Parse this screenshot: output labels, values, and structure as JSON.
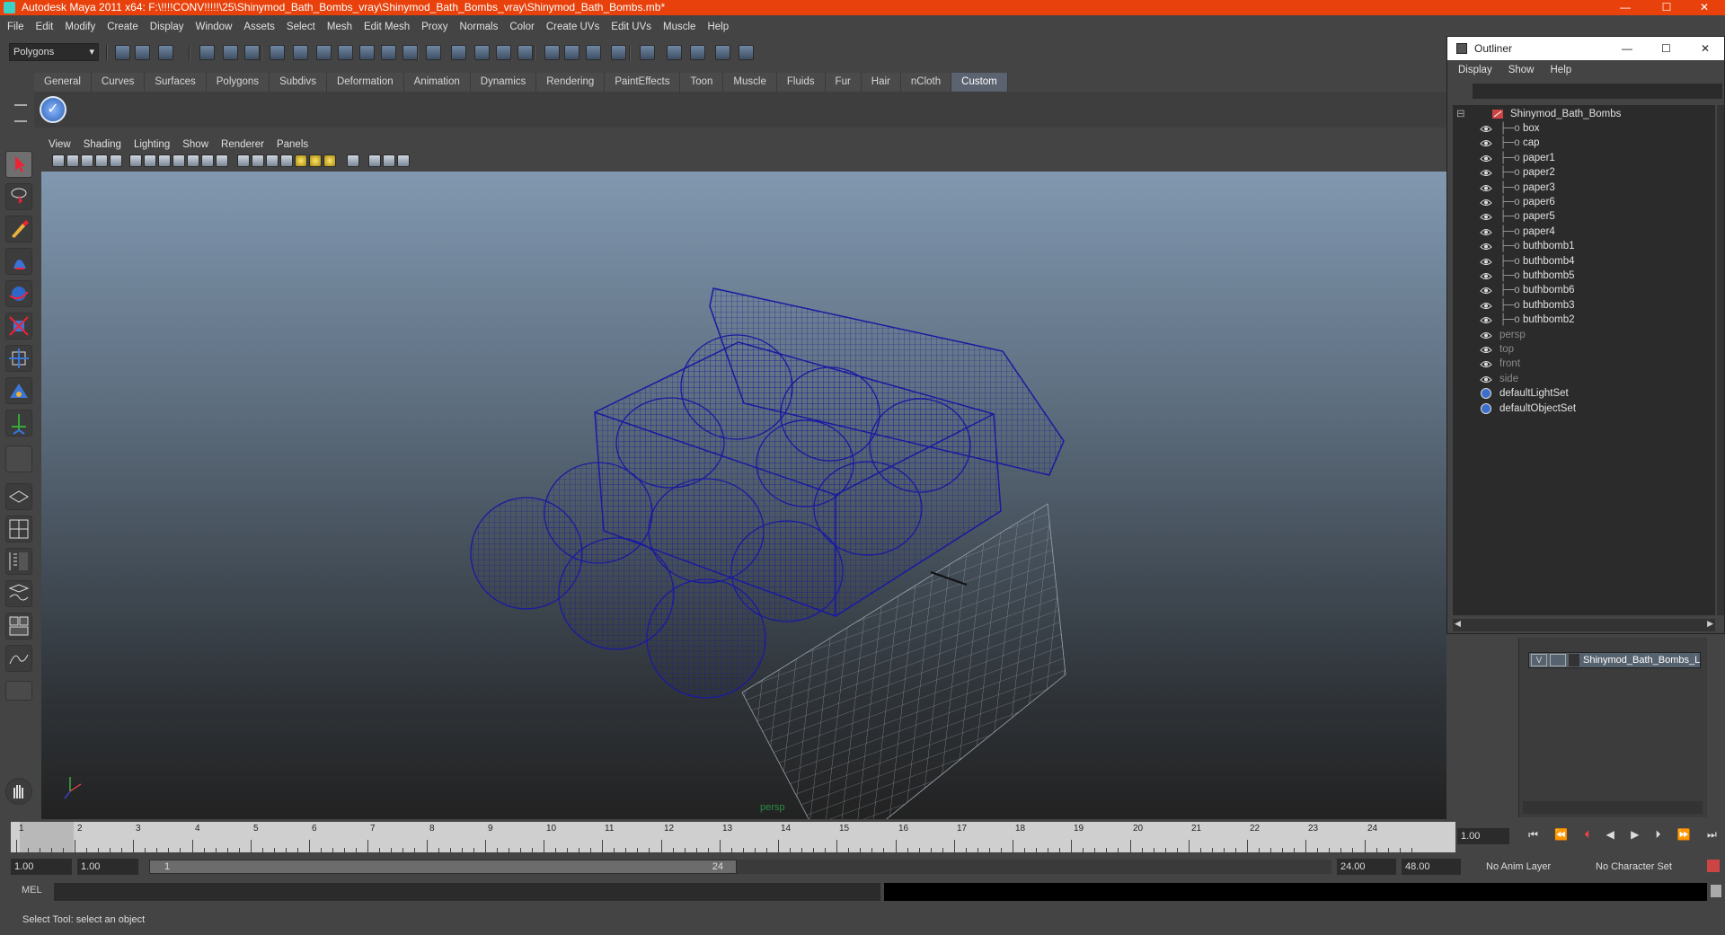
{
  "window": {
    "title": "Autodesk Maya 2011 x64: F:\\!!!!CONV!!!!!\\25\\Shinymod_Bath_Bombs_vray\\Shinymod_Bath_Bombs_vray\\Shinymod_Bath_Bombs.mb*",
    "minimize": "—",
    "maximize": "☐",
    "close": "✕"
  },
  "menubar": [
    "File",
    "Edit",
    "Modify",
    "Create",
    "Display",
    "Window",
    "Assets",
    "Select",
    "Mesh",
    "Edit Mesh",
    "Proxy",
    "Normals",
    "Color",
    "Create UVs",
    "Edit UVs",
    "Muscle",
    "Help"
  ],
  "statusline": {
    "mode": "Polygons"
  },
  "shelf": {
    "tabs": [
      "General",
      "Curves",
      "Surfaces",
      "Polygons",
      "Subdivs",
      "Deformation",
      "Animation",
      "Dynamics",
      "Rendering",
      "PaintEffects",
      "Toon",
      "Muscle",
      "Fluids",
      "Fur",
      "Hair",
      "nCloth",
      "Custom"
    ],
    "active": "Custom"
  },
  "viewport": {
    "menu": [
      "View",
      "Shading",
      "Lighting",
      "Show",
      "Renderer",
      "Panels"
    ],
    "camera": "persp"
  },
  "outliner": {
    "title": "Outliner",
    "menu": [
      "Display",
      "Show",
      "Help"
    ],
    "root": "Shinymod_Bath_Bombs",
    "children": [
      "box",
      "cap",
      "paper1",
      "paper2",
      "paper3",
      "paper6",
      "paper5",
      "paper4",
      "buthbomb1",
      "buthbomb4",
      "buthbomb5",
      "buthbomb6",
      "buthbomb3",
      "buthbomb2"
    ],
    "cameras": [
      "persp",
      "top",
      "front",
      "side"
    ],
    "sets": [
      "defaultLightSet",
      "defaultObjectSet"
    ]
  },
  "layers": {
    "visible": "V",
    "name": "Shinymod_Bath_Bombs_L"
  },
  "timeslider": {
    "ticks": [
      "1",
      "2",
      "3",
      "4",
      "5",
      "6",
      "7",
      "8",
      "9",
      "10",
      "11",
      "12",
      "13",
      "14",
      "15",
      "16",
      "17",
      "18",
      "19",
      "20",
      "21",
      "22",
      "23",
      "24"
    ],
    "current_frame": "1.00"
  },
  "range": {
    "start": "1.00",
    "playback_start": "1.00",
    "range_start_marker": "1",
    "range_end_marker": "24",
    "playback_end": "24.00",
    "end": "48.00",
    "anim_layer": "No Anim Layer",
    "char_set": "No Character Set"
  },
  "cmdline": {
    "label": "MEL"
  },
  "helpline": {
    "text": "Select Tool: select an object"
  }
}
